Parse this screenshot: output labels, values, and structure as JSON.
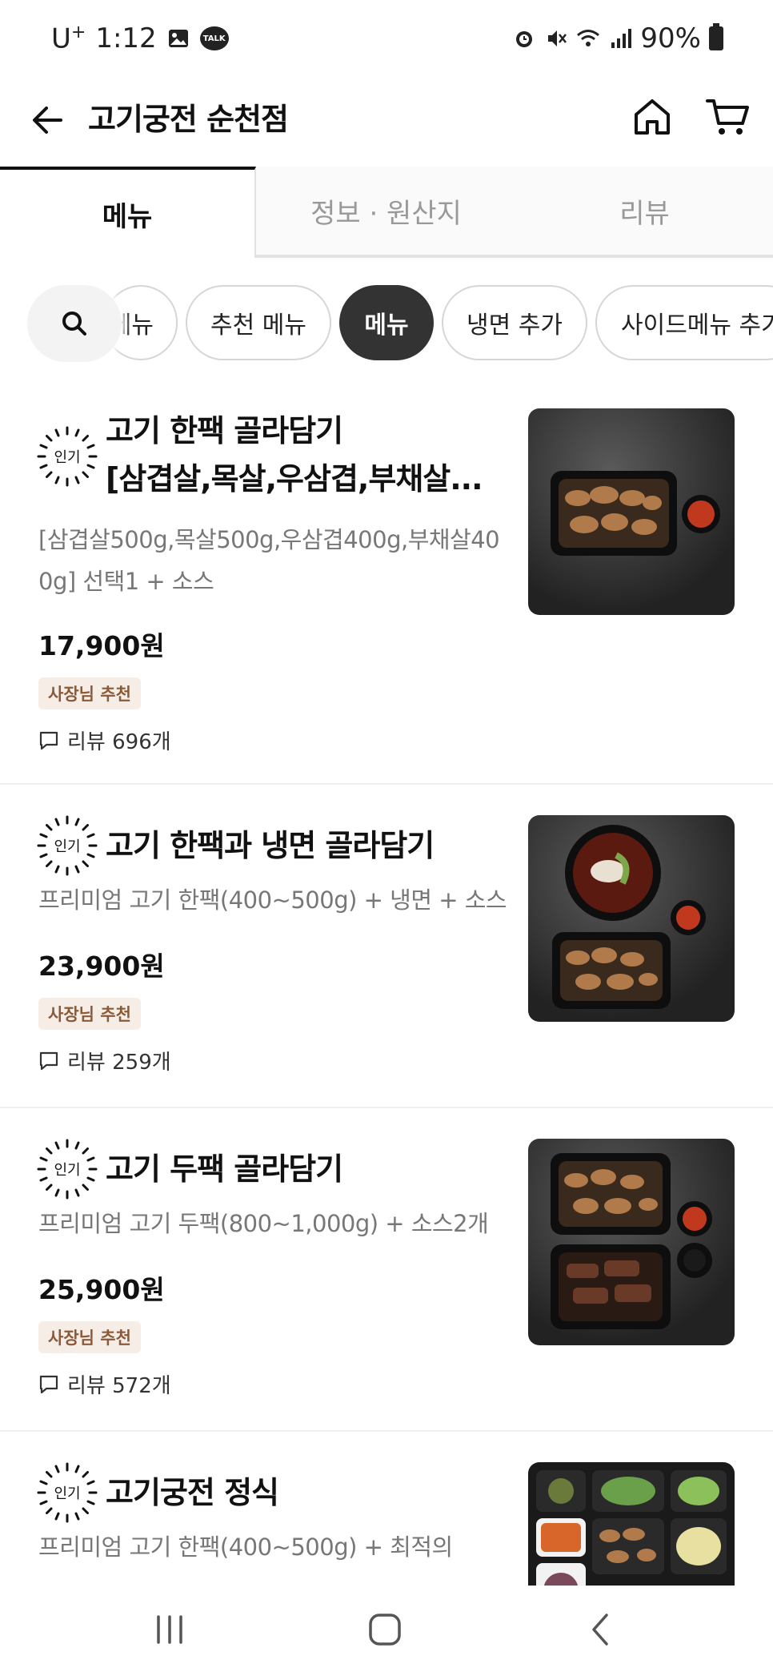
{
  "status_bar": {
    "carrier": "U",
    "carrier_sup": "+",
    "time": "1:12",
    "talk": "TALK",
    "battery": "90%"
  },
  "header": {
    "title": "고기궁전 순천점"
  },
  "tabs": [
    {
      "label": "메뉴",
      "active": true
    },
    {
      "label": "정보 · 원산지",
      "active": false
    },
    {
      "label": "리뷰",
      "active": false
    }
  ],
  "chips": {
    "partial": "메뉴",
    "recommended": "추천 메뉴",
    "menu": "메뉴",
    "noodle": "냉면 추가",
    "side": "사이드메뉴 추가"
  },
  "badge_text": "인기",
  "menu_items": [
    {
      "name_line1": "고기 한팩 골라담기",
      "name_line2": "[삼겹살,목살,우삼겹,부채살...",
      "desc_line1": "[삼겹살500g,목살500g,우삼겹400g,부채살40",
      "desc_line2": "0g] 선택1 + 소스",
      "price": "17,900원",
      "owner_badge": "사장님 추천",
      "reviews": "리뷰 696개"
    },
    {
      "name": "고기 한팩과 냉면 골라담기",
      "desc": "프리미엄 고기 한팩(400~500g) + 냉면 + 소스",
      "price": "23,900원",
      "owner_badge": "사장님 추천",
      "reviews": "리뷰 259개"
    },
    {
      "name": "고기 두팩 골라담기",
      "desc": "프리미엄 고기 두팩(800~1,000g) + 소스2개",
      "price": "25,900원",
      "owner_badge": "사장님 추천",
      "reviews": "리뷰 572개"
    },
    {
      "name": "고기궁전 정식",
      "desc": "프리미엄 고기 한팩(400~500g) + 최적의"
    }
  ],
  "colors": {
    "accent_dark": "#333333",
    "owner_badge_bg": "#f6eee6",
    "owner_badge_text": "#8a5a3a"
  }
}
